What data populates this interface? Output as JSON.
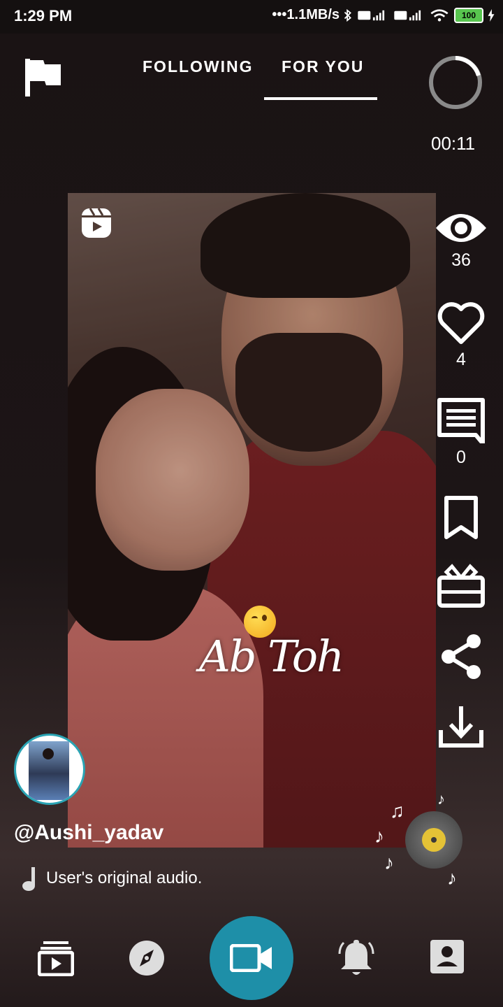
{
  "status_bar": {
    "time": "1:29 PM",
    "network_speed": "•••1.1MB/s",
    "battery": "100"
  },
  "top_nav": {
    "tabs": [
      {
        "label": "FOLLOWING",
        "active": false
      },
      {
        "label": "FOR YOU",
        "active": true
      }
    ],
    "timer": "00:11"
  },
  "video": {
    "overlay_text": "Ab Toh"
  },
  "actions": {
    "views": "36",
    "likes": "4",
    "comments": "0"
  },
  "post": {
    "username": "@Aushi_yadav",
    "audio": "User's original audio."
  },
  "bottom_nav": {
    "items": [
      "videos-icon",
      "explore-icon",
      "record-video-icon",
      "notifications-icon",
      "profile-icon"
    ]
  },
  "colors": {
    "accent": "#1e8fa8",
    "avatar_ring": "#2aa4b4",
    "battery": "#58c54f"
  }
}
